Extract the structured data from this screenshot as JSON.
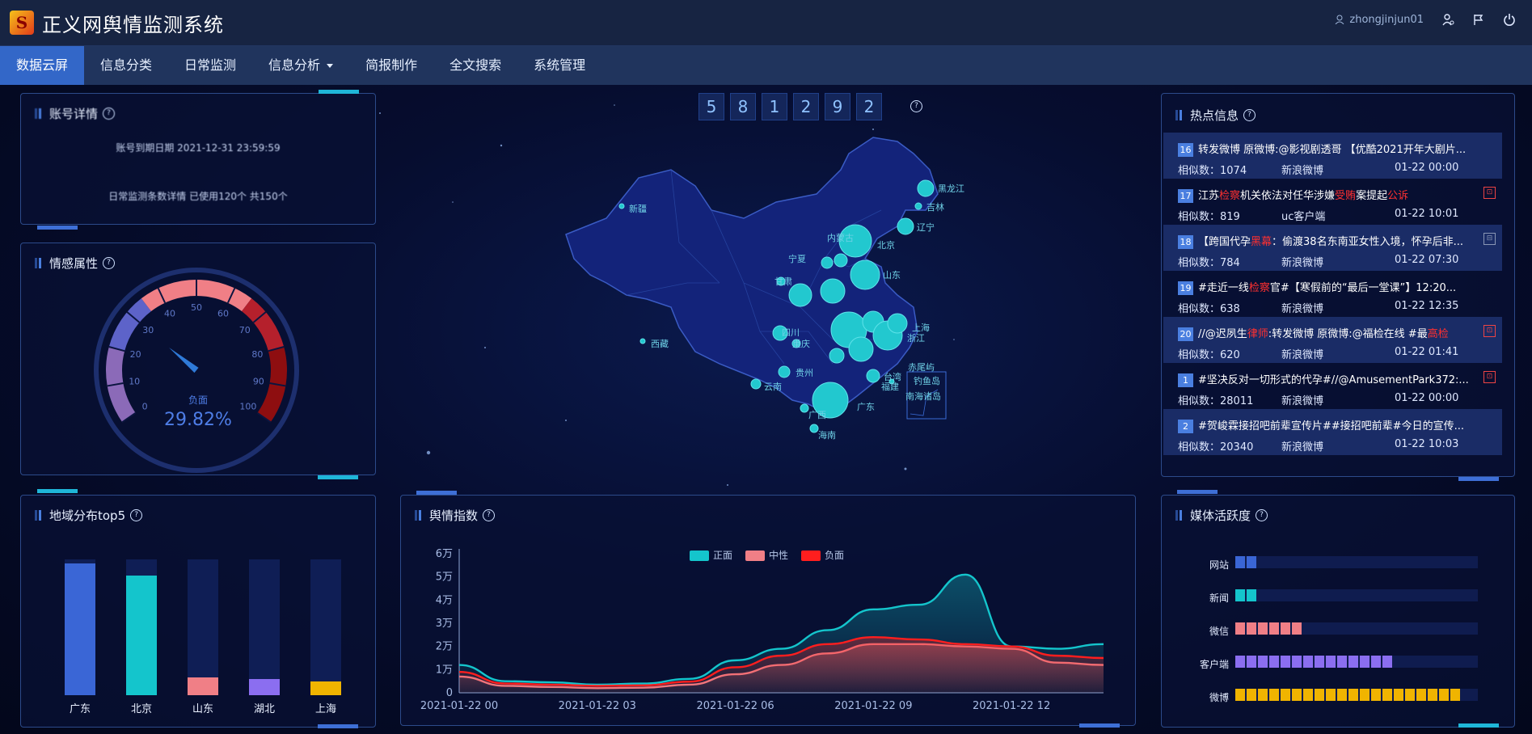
{
  "header": {
    "app_title": "正义网舆情监测系统",
    "username": "zhongjinjun01",
    "icons": [
      "user-settings-icon",
      "flag-icon",
      "power-icon"
    ]
  },
  "nav": {
    "items": [
      {
        "label": "数据云屏",
        "active": true
      },
      {
        "label": "信息分类"
      },
      {
        "label": "日常监测"
      },
      {
        "label": "信息分析",
        "dropdown": true
      },
      {
        "label": "简报制作"
      },
      {
        "label": "全文搜索"
      },
      {
        "label": "系统管理"
      }
    ]
  },
  "account": {
    "title": "账号详情",
    "line1": "账号到期日期 2021-12-31 23:59:59",
    "line2": "日常监测条数详情 已使用120个 共150个"
  },
  "sentiment": {
    "title": "情感属性",
    "gauge_label": "负面",
    "gauge_value": "29.82%",
    "value_percent": 29.82,
    "ticks": [
      "0",
      "10",
      "20",
      "30",
      "40",
      "50",
      "60",
      "70",
      "80",
      "90",
      "100"
    ]
  },
  "counter": {
    "digits": [
      "5",
      "8",
      "1",
      "2",
      "9",
      "2"
    ]
  },
  "map": {
    "labels": [
      "新疆",
      "西藏",
      "黑龙江",
      "吉林",
      "辽宁",
      "内蒙古",
      "北京",
      "宁夏",
      "甘肃",
      "山东",
      "四川",
      "重庆",
      "上海",
      "浙江",
      "贵州",
      "云南",
      "广西",
      "广东",
      "海南",
      "台湾",
      "福建",
      "南海诸岛",
      "钓鱼岛",
      "赤尾屿"
    ]
  },
  "hot": {
    "title": "热点信息",
    "items": [
      {
        "rank": "16",
        "text": "转发微博 原微博:@影视剧透哥 【优酷2021开年大剧片...",
        "count_label": "相似数：1074",
        "source": "新浪微博",
        "time": "01-22 00:00",
        "shade": true,
        "flag": ""
      },
      {
        "rank": "17",
        "pre": "江苏",
        "kw1": "检察",
        "mid": "机关依法对任华涉嫌",
        "kw2": "受贿",
        "post": "案提起",
        "kw3": "公诉",
        "count_label": "相似数：819",
        "source": "uc客户端",
        "time": "01-22 10:01",
        "shade": false,
        "flag": "red"
      },
      {
        "rank": "18",
        "pre": "【跨国代孕",
        "kw1": "黑幕",
        "mid": "：偷渡38名东南亚女性入境，怀孕后非...",
        "count_label": "相似数：784",
        "source": "新浪微博",
        "time": "01-22 07:30",
        "shade": true,
        "flag": "gray"
      },
      {
        "rank": "19",
        "pre": "#走近一线",
        "kw1": "检察",
        "mid": "官#【寒假前的“最后一堂课”】12:20...",
        "count_label": "相似数：638",
        "source": "新浪微博",
        "time": "01-22 12:35",
        "shade": false,
        "flag": ""
      },
      {
        "rank": "20",
        "pre": "//@迟夙生",
        "kw1": "律师",
        "mid": ":转发微博 原微博:@福检在线 #最",
        "kw2": "高检",
        "count_label": "相似数：620",
        "source": "新浪微博",
        "time": "01-22 01:41",
        "shade": true,
        "flag": "red"
      },
      {
        "rank": "1",
        "text": "#坚决反对一切形式的代孕#//@AmusementPark372:...",
        "count_label": "相似数：28011",
        "source": "新浪微博",
        "time": "01-22 00:00",
        "shade": false,
        "flag": "red"
      },
      {
        "rank": "2",
        "text": "#贺峻霖接招吧前辈宣传片##接招吧前辈#今日的宣传...",
        "count_label": "相似数：20340",
        "source": "新浪微博",
        "time": "01-22 10:03",
        "shade": true,
        "flag": ""
      }
    ]
  },
  "regions": {
    "title": "地域分布top5",
    "items": [
      {
        "name": "广东",
        "fill": 0.97,
        "color": "#3a66d6"
      },
      {
        "name": "北京",
        "fill": 0.88,
        "color": "#14c5cc"
      },
      {
        "name": "山东",
        "fill": 0.13,
        "color": "#f07f86"
      },
      {
        "name": "湖北",
        "fill": 0.12,
        "color": "#8b6ef0"
      },
      {
        "name": "上海",
        "fill": 0.1,
        "color": "#f0b400"
      }
    ]
  },
  "opinion": {
    "title": "舆情指数"
  },
  "chart_data": {
    "type": "area",
    "title": "",
    "x": [
      "2021-01-22 00",
      "2021-01-22 01",
      "2021-01-22 02",
      "2021-01-22 03",
      "2021-01-22 04",
      "2021-01-22 05",
      "2021-01-22 06",
      "2021-01-22 07",
      "2021-01-22 08",
      "2021-01-22 09",
      "2021-01-22 10",
      "2021-01-22 11",
      "2021-01-22 12",
      "2021-01-22 13",
      "2021-01-22 14"
    ],
    "xticks": [
      "2021-01-22 00",
      "2021-01-22 03",
      "2021-01-22 06",
      "2021-01-22 09",
      "2021-01-22 12"
    ],
    "yticks": [
      "0",
      "1万",
      "2万",
      "3万",
      "4万",
      "5万",
      "6万"
    ],
    "ylim": [
      0,
      60000
    ],
    "series": [
      {
        "name": "正面",
        "color": "#14c5cc",
        "values": [
          12000,
          5000,
          4500,
          3500,
          4000,
          6000,
          14000,
          19000,
          27000,
          36000,
          38000,
          51000,
          20000,
          19000,
          21000
        ]
      },
      {
        "name": "中性",
        "color": "#f07f86",
        "values": [
          7000,
          3000,
          2500,
          2000,
          2200,
          3500,
          8000,
          12000,
          17000,
          21000,
          21000,
          20000,
          19000,
          13000,
          12000
        ]
      },
      {
        "name": "负面",
        "color": "#ff1e1e",
        "values": [
          9000,
          4000,
          3500,
          3000,
          3200,
          4800,
          11000,
          16000,
          21000,
          24000,
          23000,
          21000,
          20000,
          16000,
          15000
        ]
      }
    ]
  },
  "media": {
    "title": "媒体活跃度",
    "items": [
      {
        "name": "网站",
        "blocks": 2,
        "color": "#3a66d6"
      },
      {
        "name": "新闻",
        "blocks": 2,
        "color": "#14c5cc"
      },
      {
        "name": "微信",
        "blocks": 6,
        "color": "#f07f86"
      },
      {
        "name": "客户端",
        "blocks": 14,
        "color": "#8b6ef0"
      },
      {
        "name": "微博",
        "blocks": 20,
        "color": "#f0b400"
      }
    ]
  }
}
